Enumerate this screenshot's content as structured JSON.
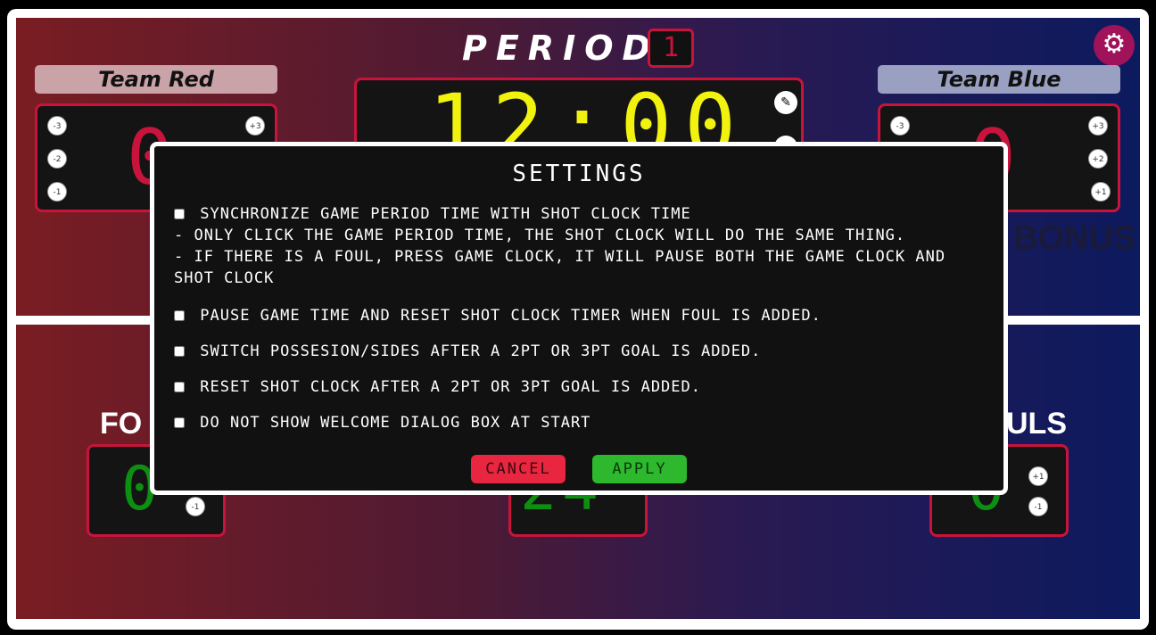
{
  "scoreboard": {
    "period_label": "PERIOD",
    "period_value": "1",
    "settings_icon": "gear-icon",
    "team_red": {
      "name": "Team Red",
      "score": "0",
      "buttons_left": [
        "-3",
        "-2",
        "-1"
      ],
      "buttons_right": [
        "+3"
      ]
    },
    "team_blue": {
      "name": "Team Blue",
      "score": "0",
      "buttons_left": [
        "-3"
      ],
      "buttons_right": [
        "+3",
        "+2",
        "+1"
      ]
    },
    "game_clock": "12:00",
    "bonus_label": "BONUS",
    "fouls_left_label": "FO",
    "fouls_right_label": "ULS",
    "fouls_left_value": "0",
    "fouls_right_value": "0",
    "shot_clock_value": "24",
    "fouls_left_minus": "-1",
    "fouls_right_plus": "+1",
    "fouls_right_minus": "-1"
  },
  "settings_dialog": {
    "title": "SETTINGS",
    "options": [
      {
        "label": "Synchronize game period time with shot clock time",
        "checked": false,
        "notes": [
          "- Only click the game period time, the shot clock will do the same thing.",
          "- If there is a foul, press game clock, it will pause both the game clock and shot clock"
        ]
      },
      {
        "label": "Pause game time and reset shot clock timer when foul is added.",
        "checked": false
      },
      {
        "label": "Switch possesion/sides after a 2pt or 3pt goal is added.",
        "checked": false
      },
      {
        "label": "Reset shot clock after a 2pt or 3pt goal is added.",
        "checked": false
      },
      {
        "label": "Do not show welcome dialog box at start",
        "checked": false
      }
    ],
    "cancel_label": "Cancel",
    "apply_label": "Apply"
  },
  "colors": {
    "accent_red": "#c8143c",
    "clock_yellow": "#f2f20f",
    "shot_green": "#0d8f12",
    "cancel_red": "#e8263f",
    "apply_green": "#2db82d"
  }
}
